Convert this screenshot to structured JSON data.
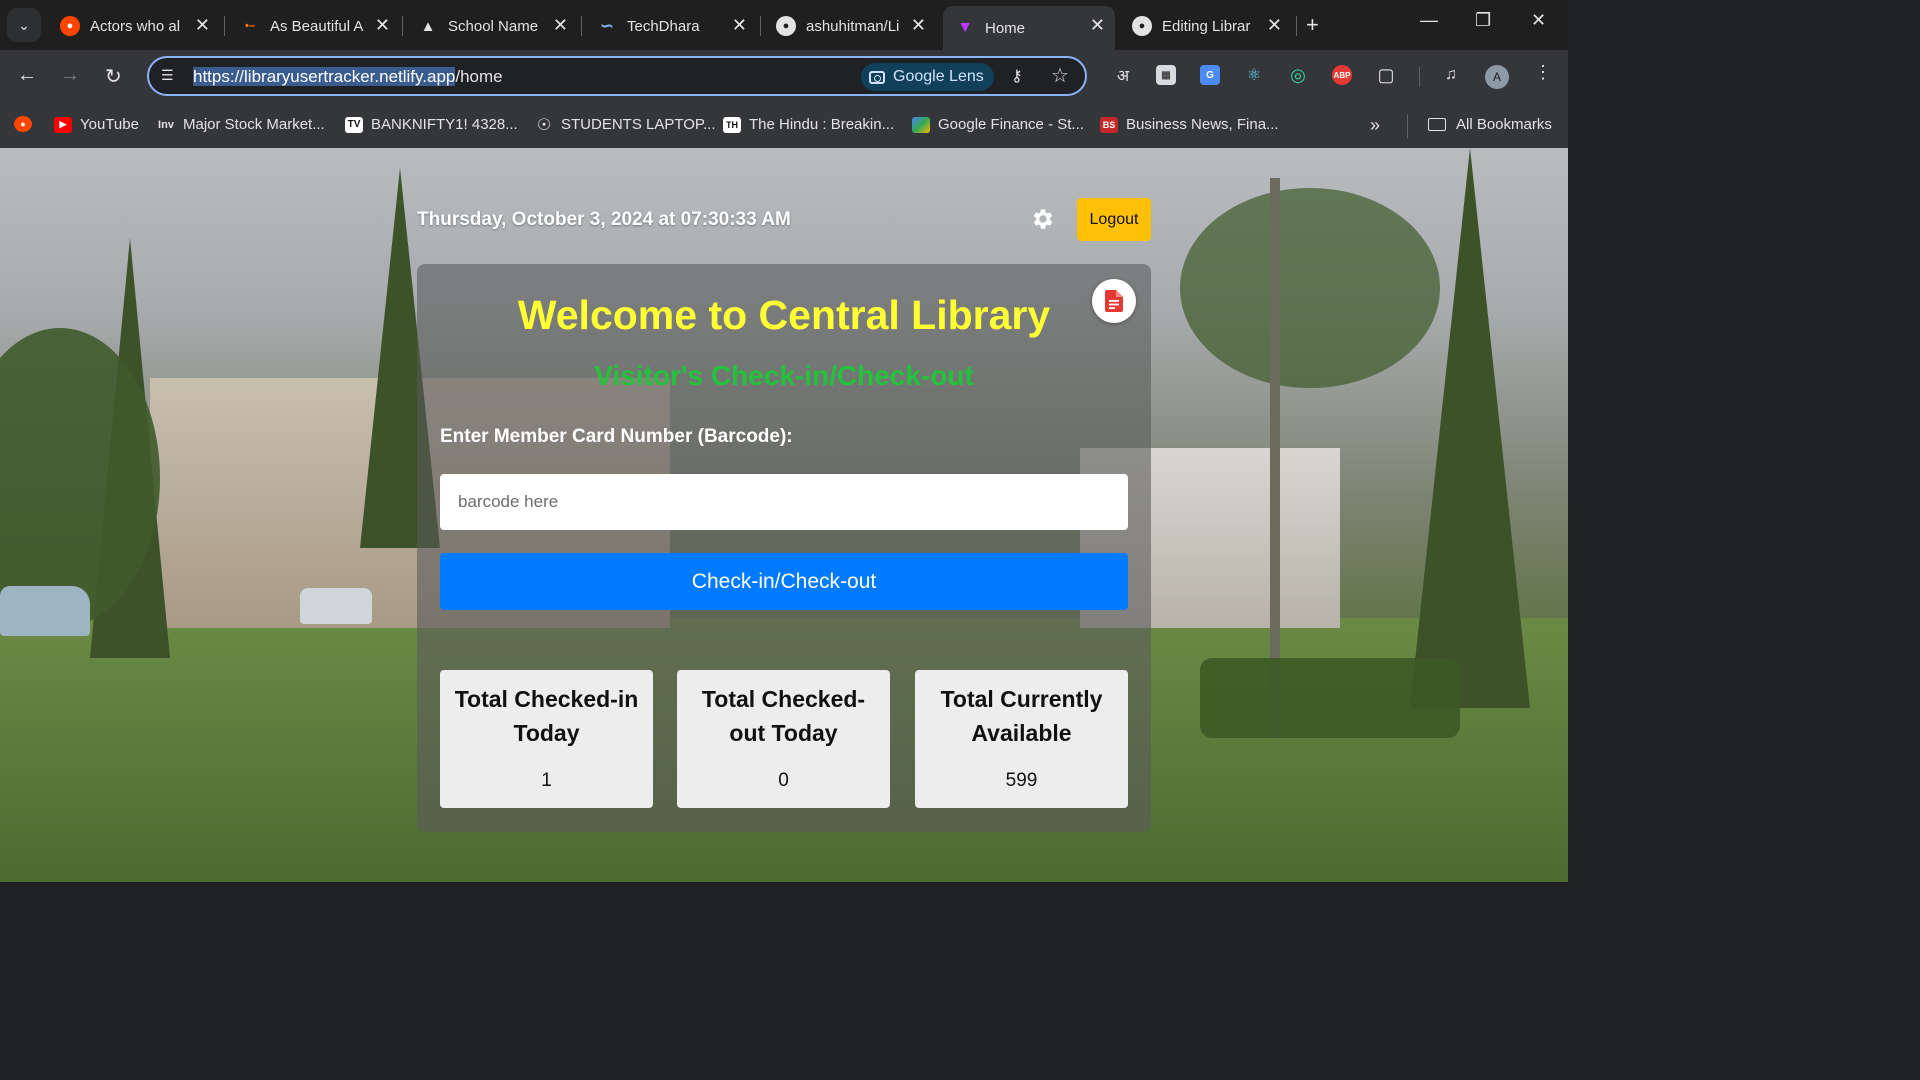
{
  "browser": {
    "tabs": [
      {
        "title": "Actors who al",
        "icon": "reddit-icon",
        "color": "#ff4500",
        "active": false
      },
      {
        "title": "As Beautiful A",
        "icon": "site-icon",
        "color": "#ff7a00",
        "active": false
      },
      {
        "title": "School Name",
        "icon": "site-icon",
        "color": "#e3e3e3",
        "active": false
      },
      {
        "title": "TechDhara",
        "icon": "site-icon",
        "color": "#8ab4f8",
        "active": false
      },
      {
        "title": "ashuhitman/Li",
        "icon": "github-icon",
        "color": "#e3e3e3",
        "active": false
      },
      {
        "title": "Home",
        "icon": "vite-icon",
        "color": "#bd34fe",
        "active": true
      },
      {
        "title": "Editing Librar",
        "icon": "github-icon",
        "color": "#e3e3e3",
        "active": false
      }
    ],
    "url_selected": "https://libraryusertracker.netlify.app",
    "url_rest": "/home",
    "lens_label": "Google Lens",
    "profile_initial": "A",
    "bookmarks": [
      {
        "label": "",
        "icon": "reddit-icon"
      },
      {
        "label": "YouTube",
        "icon": "youtube-icon"
      },
      {
        "label": "Major Stock Market...",
        "icon": "inv-icon"
      },
      {
        "label": "BANKNIFTY1! 4328...",
        "icon": "tradingview-icon"
      },
      {
        "label": "STUDENTS LAPTOP...",
        "icon": "globe-icon"
      },
      {
        "label": "The Hindu : Breakin...",
        "icon": "thehindu-icon"
      },
      {
        "label": "Google Finance - St...",
        "icon": "google-finance-icon"
      },
      {
        "label": "Business News, Fina...",
        "icon": "business-standard-icon"
      }
    ],
    "all_bookmarks_label": "All Bookmarks"
  },
  "app": {
    "datetime": "Thursday, October 3, 2024 at 07:30:33 AM",
    "logout_label": "Logout",
    "title": "Welcome to Central Library",
    "subtitle": "Visitor's Check-in/Check-out",
    "barcode_label": "Enter Member Card Number (Barcode):",
    "barcode_placeholder": "barcode here",
    "submit_label": "Check-in/Check-out",
    "stats": [
      {
        "label": "Total Checked-in Today",
        "value": "1"
      },
      {
        "label": "Total Checked-out Today",
        "value": "0"
      },
      {
        "label": "Total Currently Available",
        "value": "599"
      }
    ],
    "colors": {
      "title": "#ffff33",
      "subtitle": "#22c33a",
      "primary_button": "#007bff",
      "logout_button": "#ffc107",
      "report_icon": "#e53935"
    }
  }
}
